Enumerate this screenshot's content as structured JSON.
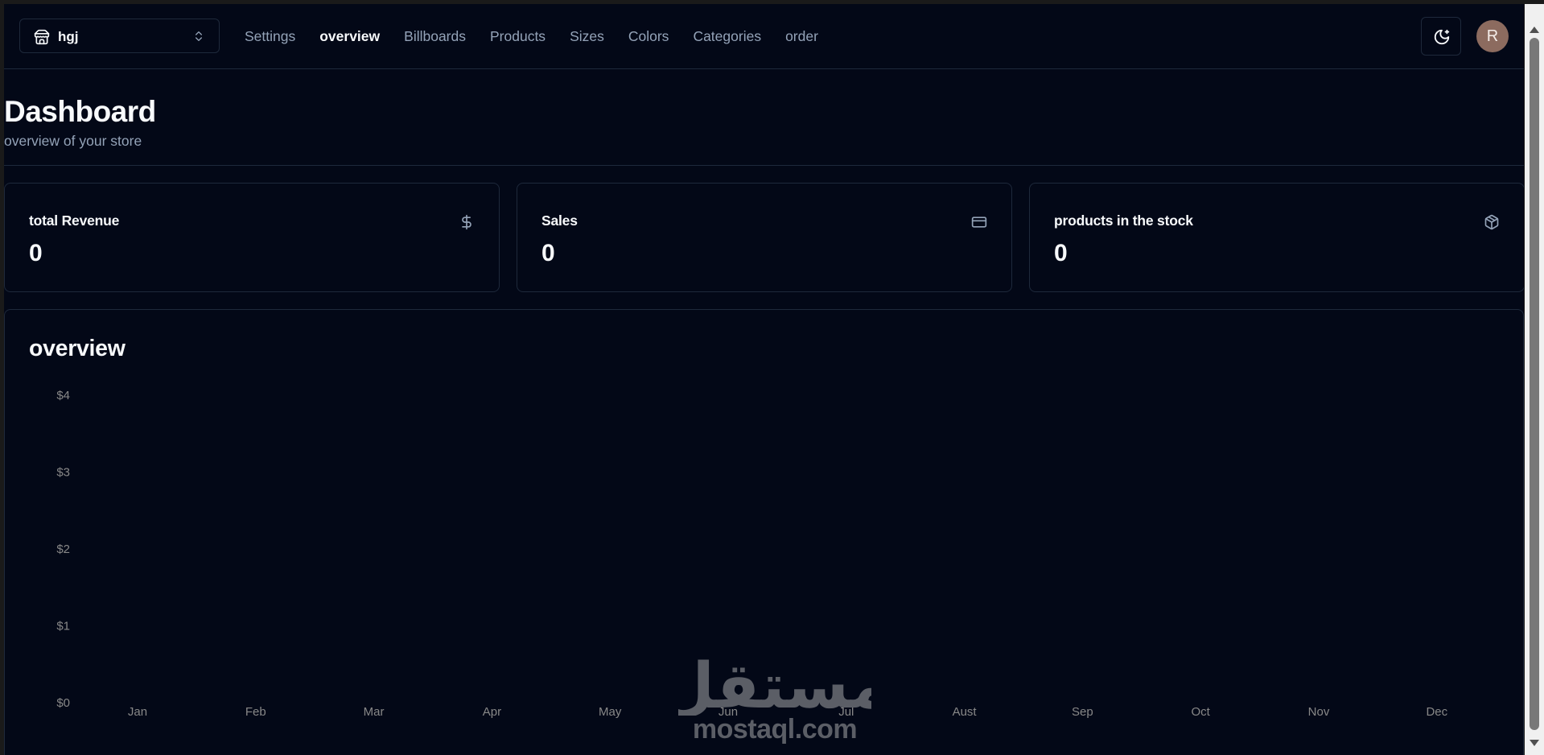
{
  "navbar": {
    "store_switcher": {
      "name": "hgj"
    },
    "links": [
      {
        "label": "Settings",
        "active": false
      },
      {
        "label": "overview",
        "active": true
      },
      {
        "label": "Billboards",
        "active": false
      },
      {
        "label": "Products",
        "active": false
      },
      {
        "label": "Sizes",
        "active": false
      },
      {
        "label": "Colors",
        "active": false
      },
      {
        "label": "Categories",
        "active": false
      },
      {
        "label": "order",
        "active": false
      }
    ],
    "avatar_initial": "R"
  },
  "heading": {
    "title": "Dashboard",
    "subtitle": "overview of your store"
  },
  "stats": [
    {
      "label": "total Revenue",
      "value": "0",
      "icon": "dollar-sign-icon"
    },
    {
      "label": "Sales",
      "value": "0",
      "icon": "credit-card-icon"
    },
    {
      "label": "products in the stock",
      "value": "0",
      "icon": "package-icon"
    }
  ],
  "overview": {
    "title": "overview"
  },
  "chart_data": {
    "type": "bar",
    "categories": [
      "Jan",
      "Feb",
      "Mar",
      "Apr",
      "May",
      "Jun",
      "Jul",
      "Aust",
      "Sep",
      "Oct",
      "Nov",
      "Dec"
    ],
    "values": [
      0,
      0,
      0,
      0,
      0,
      0,
      0,
      0,
      0,
      0,
      0,
      0
    ],
    "ytick_labels": [
      "$0",
      "$1",
      "$2",
      "$3",
      "$4"
    ],
    "ylim": [
      0,
      4
    ],
    "title": "",
    "xlabel": "",
    "ylabel": "",
    "grid": false
  },
  "watermark": {
    "arabic": "مستقل",
    "text": "mostaql.com"
  },
  "colors": {
    "background": "#030817",
    "border": "#1e293b",
    "muted_text": "#94a3b8",
    "tick_text": "#888888",
    "avatar": "#8c6b5f"
  }
}
